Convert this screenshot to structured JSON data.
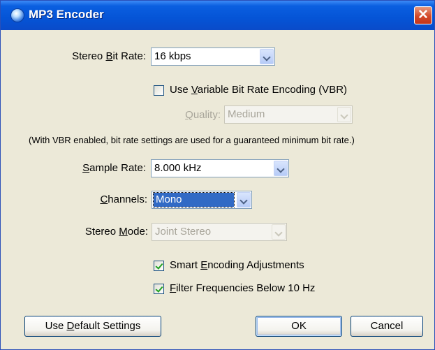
{
  "window": {
    "title": "MP3 Encoder",
    "close": "✕"
  },
  "bit_rate": {
    "label_pre": "Stereo ",
    "label_key": "B",
    "label_post": "it Rate:",
    "value": "16 kbps"
  },
  "vbr": {
    "checked": false,
    "label_pre": "Use ",
    "label_key": "V",
    "label_post": "ariable Bit Rate Encoding (VBR)"
  },
  "quality": {
    "label_key": "Q",
    "label_post": "uality:",
    "value": "Medium",
    "enabled": false
  },
  "vbr_note": "(With VBR enabled, bit rate settings are used for a guaranteed minimum bit rate.)",
  "sample_rate": {
    "label_key": "S",
    "label_post": "ample Rate:",
    "value": "8.000 kHz"
  },
  "channels": {
    "label_key": "C",
    "label_post": "hannels:",
    "value": "Mono"
  },
  "stereo_mode": {
    "label_pre": "Stereo ",
    "label_key": "M",
    "label_post": "ode:",
    "value": "Joint Stereo",
    "enabled": false
  },
  "smart_encoding": {
    "checked": true,
    "label_pre": "Smart ",
    "label_key": "E",
    "label_post": "ncoding Adjustments"
  },
  "filter_freq": {
    "checked": true,
    "label_key": "F",
    "label_post": "ilter Frequencies Below 10 Hz"
  },
  "buttons": {
    "defaults": {
      "pre": "Use ",
      "key": "D",
      "post": "efault Settings"
    },
    "ok": {
      "pre": "",
      "key": "",
      "post": "OK"
    },
    "cancel": {
      "pre": "",
      "key": "",
      "post": "Cancel"
    }
  }
}
